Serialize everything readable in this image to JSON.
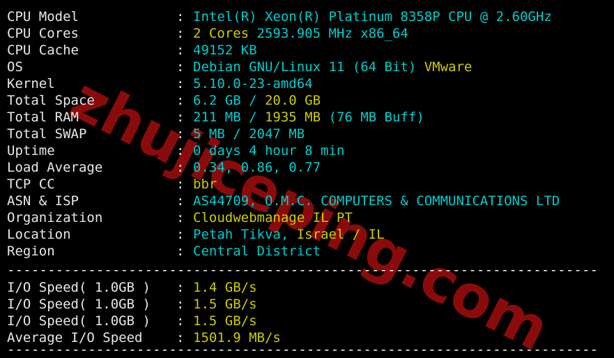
{
  "terminal": {
    "background": "#000000",
    "label_color": "#e8e8e8",
    "cyan": "#00cdcd",
    "yellow": "#cdcd00",
    "separator_top": "-------------------------------------------------------------------------",
    "separator_middle": "-------------------------------------------------------------------------",
    "separator_bottom": "-------------------------------------------------------------------------",
    "colon": ":"
  },
  "watermark": {
    "text": "zhujiceping.com",
    "color": "#8a0b0b",
    "rotation_deg": 27
  },
  "info_rows": [
    {
      "label": "CPU Model",
      "segments": [
        {
          "text": "Intel(R) Xeon(R) Platinum 8358P CPU @ 2.60GHz",
          "color": "cyan"
        }
      ]
    },
    {
      "label": "CPU Cores",
      "segments": [
        {
          "text": "2 Cores",
          "color": "yellow"
        },
        {
          "text": " 2593.905 MHz x86_64",
          "color": "cyan"
        }
      ]
    },
    {
      "label": "CPU Cache",
      "segments": [
        {
          "text": "49152 KB",
          "color": "cyan"
        }
      ]
    },
    {
      "label": "OS",
      "segments": [
        {
          "text": "Debian GNU/Linux 11 (64 Bit) ",
          "color": "cyan"
        },
        {
          "text": "VMware",
          "color": "yellow"
        }
      ]
    },
    {
      "label": "Kernel",
      "segments": [
        {
          "text": "5.10.0-23-amd64",
          "color": "cyan"
        }
      ]
    },
    {
      "label": "Total Space",
      "segments": [
        {
          "text": "6.2 GB ",
          "color": "cyan"
        },
        {
          "text": "/ ",
          "color": "cyan"
        },
        {
          "text": "20.0 GB",
          "color": "yellow"
        }
      ]
    },
    {
      "label": "Total RAM",
      "segments": [
        {
          "text": "211 MB ",
          "color": "cyan"
        },
        {
          "text": "/ ",
          "color": "cyan"
        },
        {
          "text": "1935 MB",
          "color": "yellow"
        },
        {
          "text": " (76 MB Buff)",
          "color": "cyan"
        }
      ]
    },
    {
      "label": "Total SWAP",
      "segments": [
        {
          "text": "5 MB / 2047 MB",
          "color": "cyan"
        }
      ]
    },
    {
      "label": "Uptime",
      "segments": [
        {
          "text": "0 days 4 hour 8 min",
          "color": "cyan"
        }
      ]
    },
    {
      "label": "Load Average",
      "segments": [
        {
          "text": "0.34, 0.86, 0.77",
          "color": "cyan"
        }
      ]
    },
    {
      "label": "TCP CC",
      "segments": [
        {
          "text": "bbr",
          "color": "yellow"
        }
      ]
    },
    {
      "label": "ASN & ISP",
      "segments": [
        {
          "text": "AS44709, O.M.C. COMPUTERS & COMMUNICATIONS LTD",
          "color": "cyan"
        }
      ]
    },
    {
      "label": "Organization",
      "segments": [
        {
          "text": "Cloudwebmanage IL PT",
          "color": "yellow"
        }
      ]
    },
    {
      "label": "Location",
      "segments": [
        {
          "text": "Petah Tikva, ",
          "color": "cyan"
        },
        {
          "text": "Israel / IL",
          "color": "yellow"
        }
      ]
    },
    {
      "label": "Region",
      "segments": [
        {
          "text": "Central District",
          "color": "cyan"
        }
      ]
    }
  ],
  "io_rows": [
    {
      "label": "I/O Speed( 1.0GB )",
      "segments": [
        {
          "text": "1.4 GB/s",
          "color": "yellow"
        }
      ]
    },
    {
      "label": "I/O Speed( 1.0GB )",
      "segments": [
        {
          "text": "1.5 GB/s",
          "color": "yellow"
        }
      ]
    },
    {
      "label": "I/O Speed( 1.0GB )",
      "segments": [
        {
          "text": "1.5 GB/s",
          "color": "yellow"
        }
      ]
    },
    {
      "label": "Average I/O Speed",
      "segments": [
        {
          "text": "1501.9 MB/s",
          "color": "yellow"
        }
      ]
    }
  ]
}
